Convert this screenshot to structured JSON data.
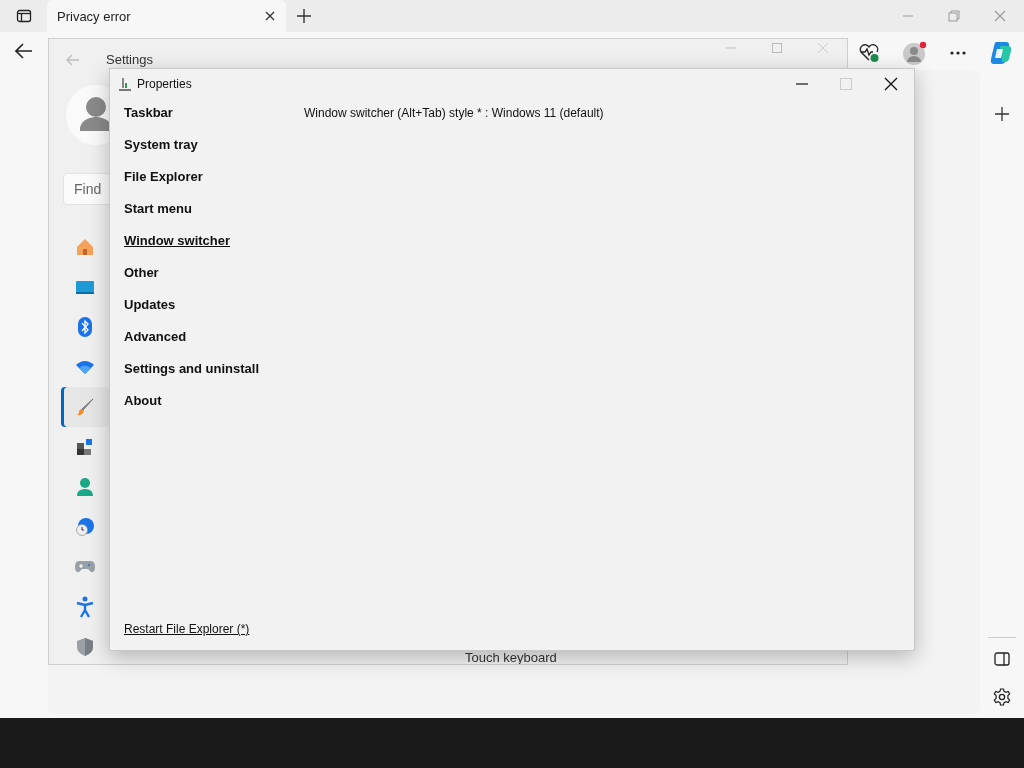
{
  "browser": {
    "tab": {
      "title": "Privacy error"
    }
  },
  "settings_window": {
    "title": "Settings",
    "search": {
      "placeholder": "Find"
    },
    "nav": [
      {
        "kind": "home",
        "selected": false
      },
      {
        "kind": "display",
        "selected": false
      },
      {
        "kind": "bluetooth",
        "selected": false
      },
      {
        "kind": "wifi",
        "selected": false
      },
      {
        "kind": "brush",
        "selected": true
      },
      {
        "kind": "apps",
        "selected": false
      },
      {
        "kind": "person",
        "selected": false
      },
      {
        "kind": "time",
        "selected": false
      },
      {
        "kind": "gaming",
        "selected": false
      },
      {
        "kind": "accessibility",
        "selected": false
      },
      {
        "kind": "shield",
        "selected": false
      }
    ],
    "content_text": "Touch keyboard"
  },
  "properties": {
    "title": "Properties",
    "sections": [
      {
        "label": "Taskbar",
        "selected": false
      },
      {
        "label": "System tray",
        "selected": false
      },
      {
        "label": "File Explorer",
        "selected": false
      },
      {
        "label": "Start menu",
        "selected": false
      },
      {
        "label": "Window switcher",
        "selected": true
      },
      {
        "label": "Other",
        "selected": false
      },
      {
        "label": "Updates",
        "selected": false
      },
      {
        "label": "Advanced",
        "selected": false
      },
      {
        "label": "Settings and uninstall",
        "selected": false
      },
      {
        "label": "About",
        "selected": false
      }
    ],
    "option": "Window switcher (Alt+Tab) style * : Windows 11 (default)",
    "restart_link": "Restart File Explorer (*)"
  }
}
